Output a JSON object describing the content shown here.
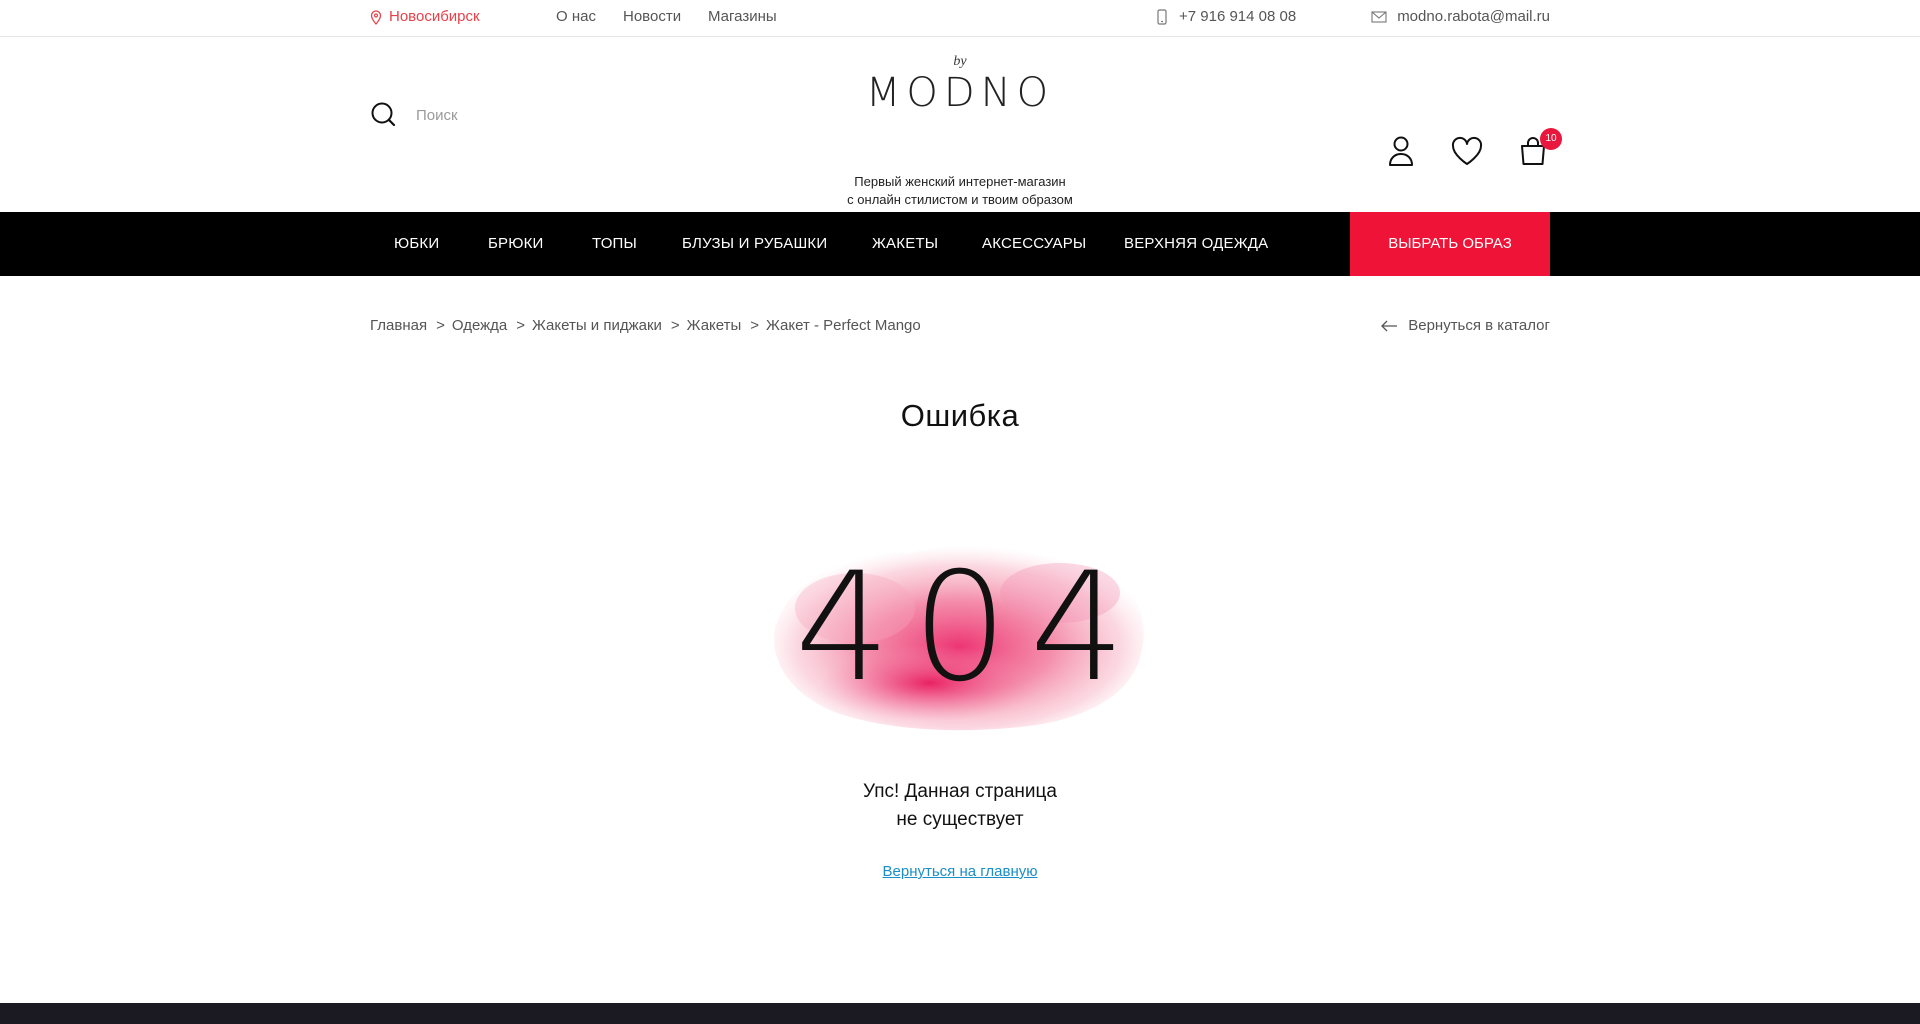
{
  "topbar": {
    "city": "Новосибирск",
    "links": [
      "О нас",
      "Новости",
      "Магазины"
    ],
    "phone": "+7 916 914 08 08",
    "email": "modno.rabota@mail.ru"
  },
  "header": {
    "search_placeholder": "Поиск",
    "logo_by": "by",
    "logo_word": "MODNO",
    "tagline_line1": "Первый женский интернет-магазин",
    "tagline_line2": "с онлайн стилистом и твоим образом",
    "cart_count": "10",
    "icons": [
      "user-icon",
      "heart-icon",
      "cart-icon"
    ]
  },
  "nav": {
    "items": [
      "ЮБКИ",
      "БРЮКИ",
      "ТОПЫ",
      "БЛУЗЫ И РУБАШКИ",
      "ЖАКЕТЫ",
      "АКСЕССУАРЫ",
      "ВЕРХНЯЯ ОДЕЖДА"
    ],
    "cta": "ВЫБРАТЬ ОБРАЗ"
  },
  "breadcrumb": {
    "items": [
      "Главная",
      "Одежда",
      "Жакеты и пиджаки",
      "Жакеты",
      "Жакет - Perfect Mango"
    ],
    "separator": ">",
    "back": "Вернуться в каталог"
  },
  "main": {
    "title": "Ошибка",
    "code": "404",
    "message_line1": "Упс! Данная страница",
    "message_line2": "не существует",
    "home_link": "Вернуться на главную"
  },
  "colors": {
    "accent": "#ee1337",
    "city": "#e8414a",
    "link": "#1b8ec8",
    "nav_bg": "#000000",
    "splash": "#f06292"
  }
}
